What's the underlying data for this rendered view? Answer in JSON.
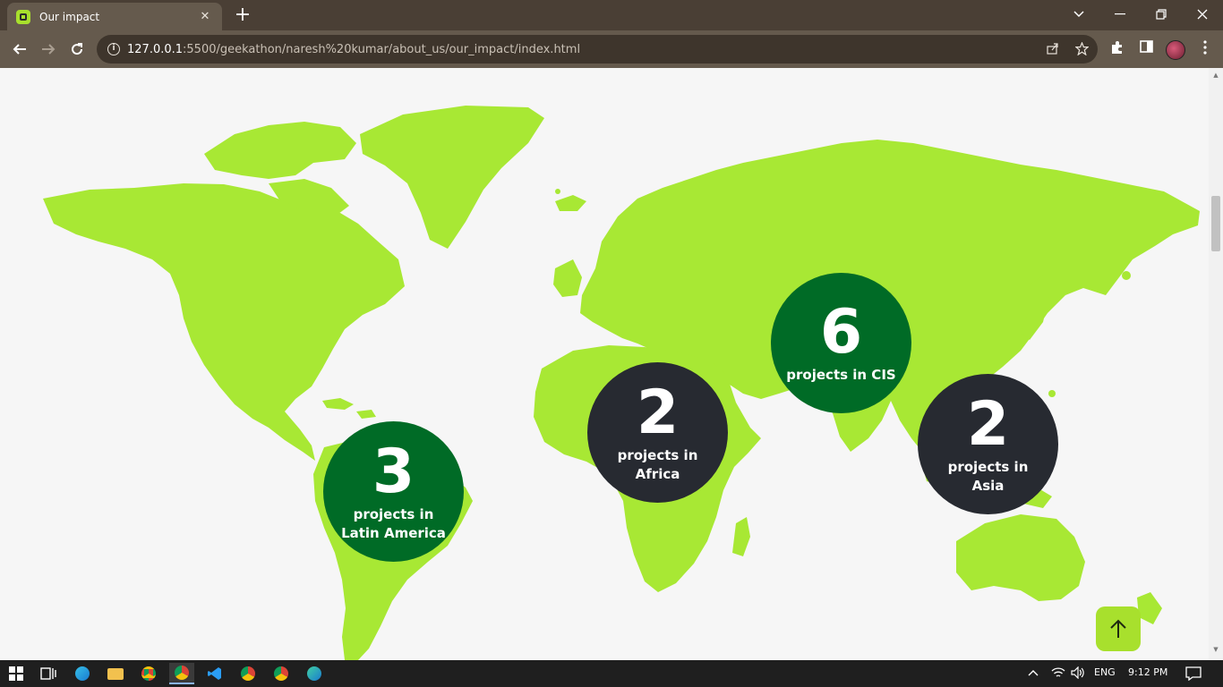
{
  "browser": {
    "tab_title": "Our impact",
    "tab_close": "✕",
    "new_tab": "+",
    "url_host": "127.0.0.1",
    "url_path": ":5500/geekathon/naresh%20kumar/about_us/our_impact/index.html"
  },
  "colors": {
    "map_land": "#a8e834",
    "accent_green": "#006b26",
    "dark": "#272a31",
    "brand_lime": "#a8e02d"
  },
  "impact": [
    {
      "number": "3",
      "label": "projects in Latin America",
      "style": "green"
    },
    {
      "number": "2",
      "label": "projects in Africa",
      "style": "dark"
    },
    {
      "number": "6",
      "label": "projects in CIS",
      "style": "green"
    },
    {
      "number": "2",
      "label": "projects in Asia",
      "style": "dark"
    }
  ],
  "taskbar": {
    "language": "ENG",
    "time": "9:12 PM"
  }
}
